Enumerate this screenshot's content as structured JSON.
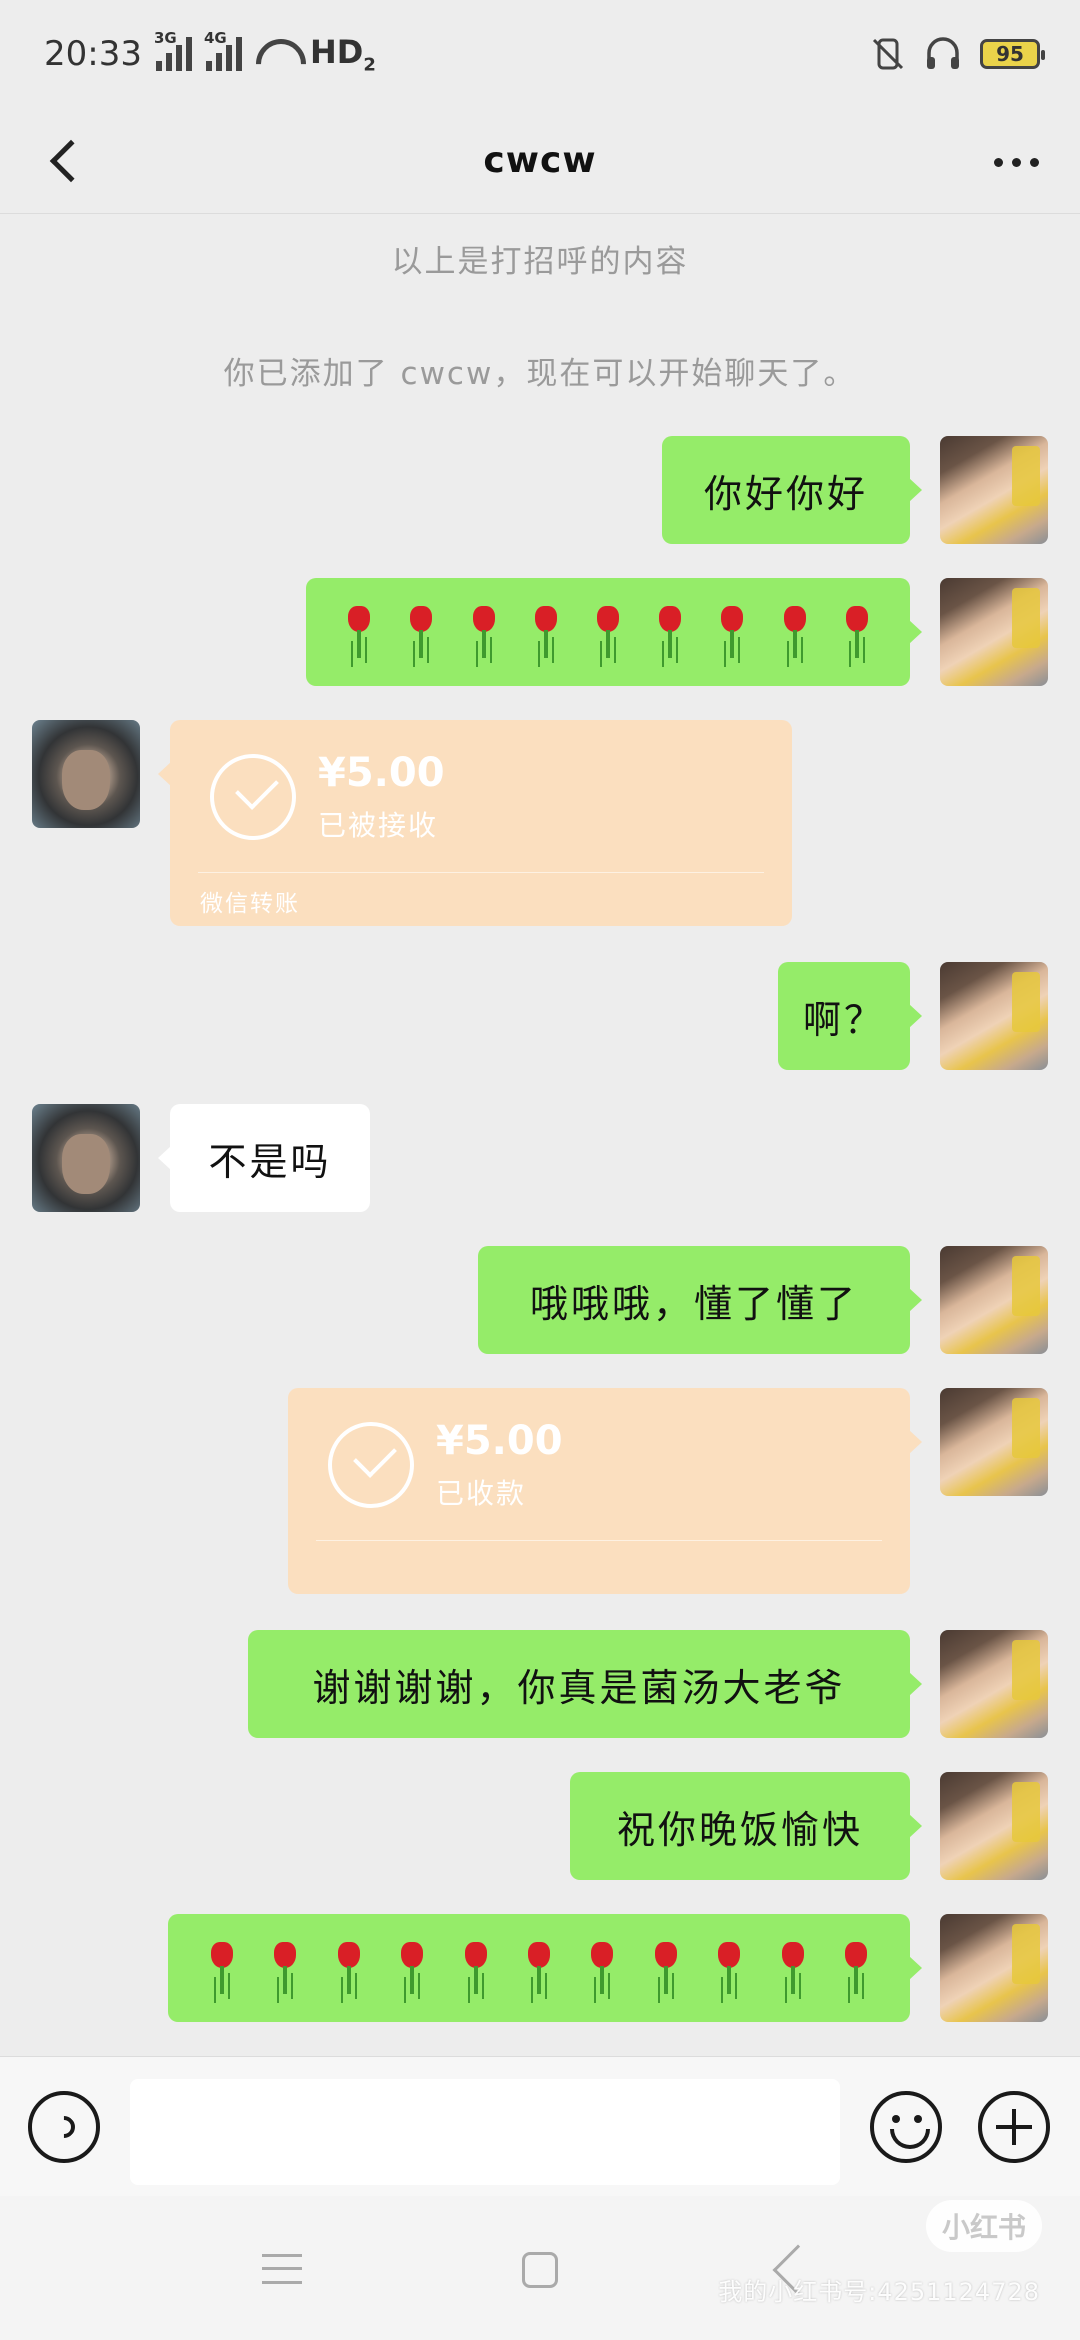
{
  "status_bar": {
    "time": "20:33",
    "signal1_label": "3G",
    "signal2_label": "4G",
    "network": "HD",
    "network_sub": "2",
    "battery": "95"
  },
  "header": {
    "title": "cwcw"
  },
  "chat": {
    "system_messages": [
      "以上是打招呼的内容",
      "你已添加了 cwcw，现在可以开始聊天了。"
    ],
    "messages": [
      {
        "from": "me",
        "type": "text",
        "text": "你好你好"
      },
      {
        "from": "me",
        "type": "emoji",
        "emoji": "rose",
        "count": 9
      },
      {
        "from": "them",
        "type": "transfer",
        "amount": "¥5.00",
        "status": "已被接收",
        "footer": "微信转账"
      },
      {
        "from": "me",
        "type": "text",
        "text": "啊？"
      },
      {
        "from": "them",
        "type": "text",
        "text": "不是吗"
      },
      {
        "from": "me",
        "type": "text",
        "text": "哦哦哦，懂了懂了"
      },
      {
        "from": "me",
        "type": "transfer",
        "amount": "¥5.00",
        "status": "已收款",
        "footer": ""
      },
      {
        "from": "me",
        "type": "text",
        "text": "谢谢谢谢，你真是菌汤大老爷"
      },
      {
        "from": "me",
        "type": "text",
        "text": "祝你晚饭愉快"
      },
      {
        "from": "me",
        "type": "emoji",
        "emoji": "rose",
        "count": 11
      }
    ]
  },
  "input_bar": {
    "value": "",
    "icons": [
      "voice-icon",
      "emoji-icon",
      "plus-icon"
    ]
  },
  "watermark": {
    "badge": "小红书",
    "text": "我的小红书号:4251124728"
  },
  "colors": {
    "sent_bubble": "#95ec69",
    "received_bubble": "#ffffff",
    "transfer_card": "#fbdfbf",
    "background": "#ededed"
  }
}
